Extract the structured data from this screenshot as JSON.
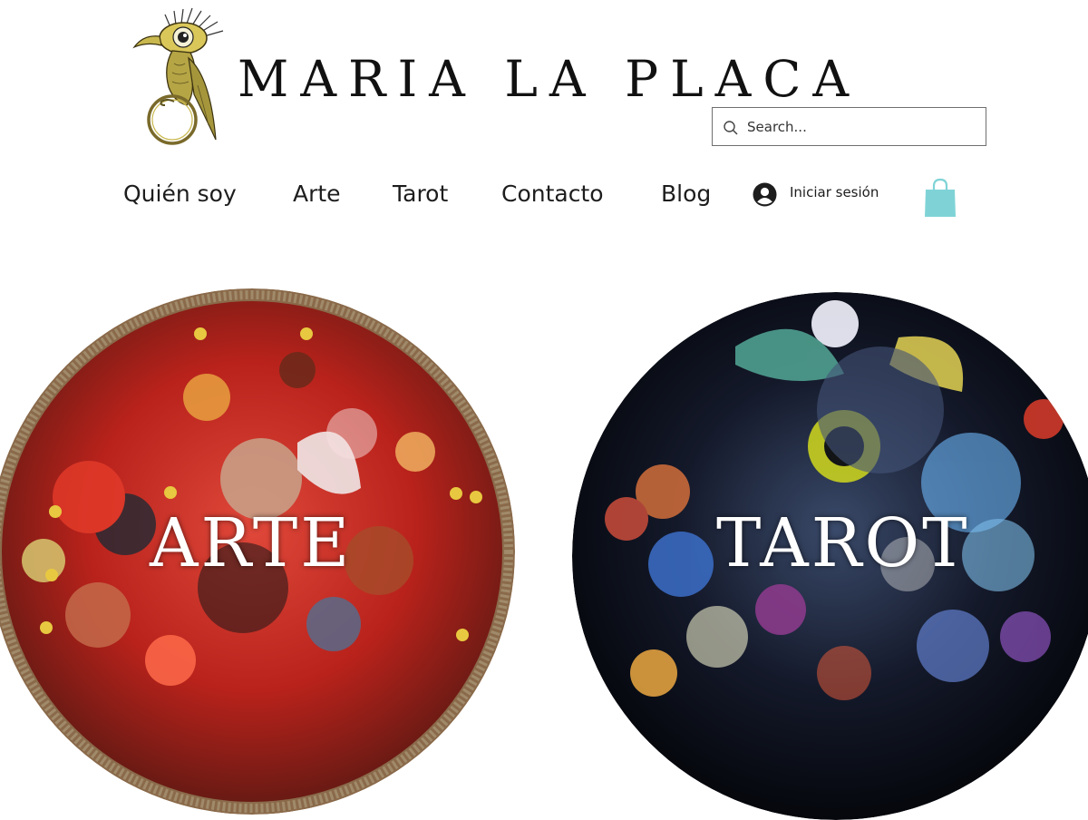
{
  "header": {
    "site_title": "MARIA LA PLACA",
    "logo_icon": "eye-bird-logo-icon"
  },
  "search": {
    "placeholder": "Search...",
    "value": "",
    "icon": "search-icon"
  },
  "nav": {
    "items": [
      {
        "label": "Quién soy"
      },
      {
        "label": "Arte"
      },
      {
        "label": "Tarot"
      },
      {
        "label": "Contacto"
      },
      {
        "label": "Blog"
      }
    ]
  },
  "login": {
    "label": "Iniciar sesión",
    "icon": "user-avatar-icon"
  },
  "cart": {
    "icon": "shopping-bag-icon",
    "color": "#7fd3d6"
  },
  "sections": {
    "arte": {
      "label": "ARTE"
    },
    "tarot": {
      "label": "TAROT"
    }
  },
  "colors": {
    "text": "#111111",
    "cart_accent": "#7fd3d6",
    "arte_base": "#c8281e",
    "tarot_base": "#0f1420"
  }
}
